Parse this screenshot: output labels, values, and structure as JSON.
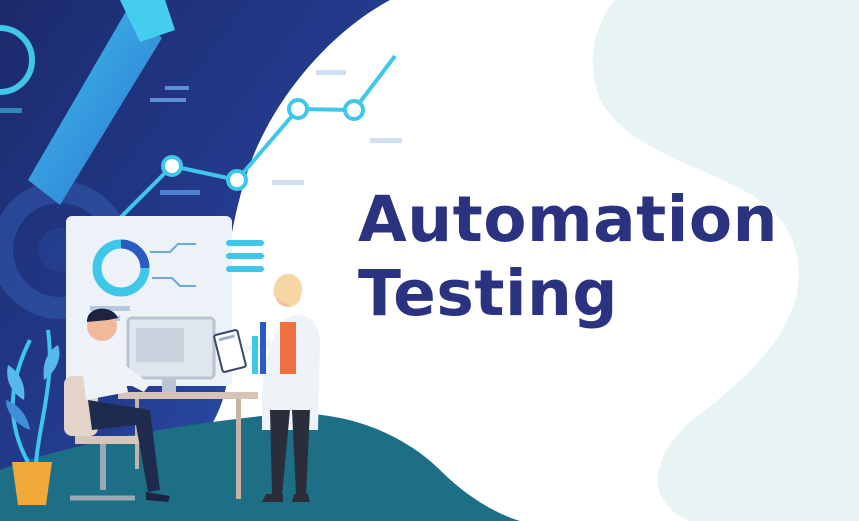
{
  "headline": {
    "line1": "Automation",
    "line2": "Testing"
  },
  "colors": {
    "title": "#2b3380",
    "navy_dark": "#1e2a6e",
    "navy_light": "#2e52a8",
    "accent_cyan": "#3ec7e8",
    "teal_floor": "#1d6f86",
    "pale_blob": "#e8f3f4"
  },
  "illustration": {
    "icons": [
      "gear-icon",
      "wrench-icon",
      "line-chart-icon",
      "donut-chart-icon",
      "computer-monitor-icon",
      "clipboard-icon",
      "plant-icon"
    ],
    "people": [
      "seated-developer",
      "standing-tester"
    ]
  }
}
